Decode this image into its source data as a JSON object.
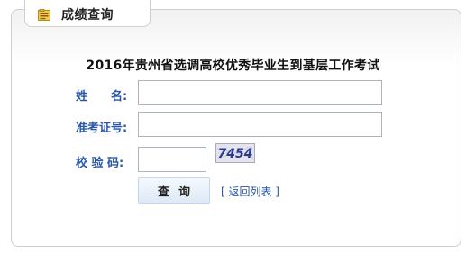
{
  "tab": {
    "title": "成绩查询",
    "icon": "report-icon"
  },
  "form": {
    "heading": "2016年贵州省选调高校优秀毕业生到基层工作考试",
    "name_label": "姓　　名:",
    "name_value": "",
    "ticket_label": "准考证号:",
    "ticket_value": "",
    "captcha_label": "校 验 码:",
    "captcha_value": "",
    "captcha_image_text": "7454",
    "query_button": "查询",
    "back_link": "[ 返回列表 ]"
  },
  "colors": {
    "label_blue": "#2a56a6",
    "link_blue": "#2a56a6",
    "border_gray": "#cfcfcf"
  }
}
